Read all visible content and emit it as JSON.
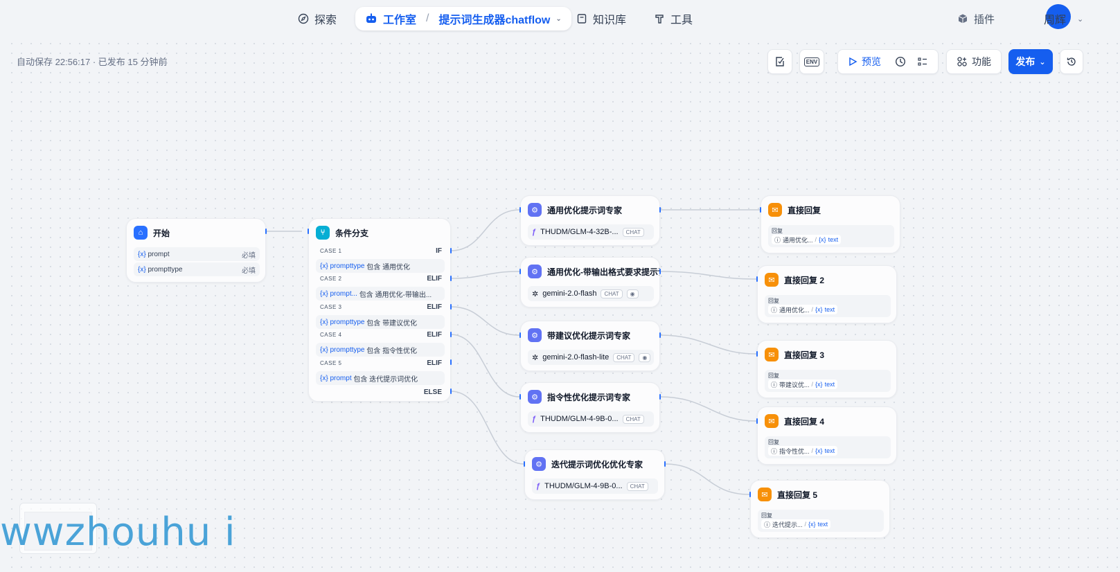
{
  "nav": {
    "explore": "探索",
    "studio": "工作室",
    "app_name": "提示词生成器chatflow",
    "knowledge": "知识库",
    "tools": "工具",
    "plugins": "插件",
    "user": "周辉"
  },
  "status": {
    "autosave": "自动保存 22:56:17 · 已发布 15 分钟前"
  },
  "toolbar": {
    "env": "ENV",
    "preview": "预览",
    "features": "功能",
    "publish": "发布"
  },
  "nodes": {
    "start": {
      "title": "开始",
      "vars": [
        {
          "name": "prompt",
          "req": "必填"
        },
        {
          "name": "prompttype",
          "req": "必填"
        }
      ]
    },
    "branch": {
      "title": "条件分支",
      "cases": [
        {
          "label": "CASE 1",
          "kw": "IF",
          "var": "prompttype",
          "op": "包含",
          "val": "通用优化"
        },
        {
          "label": "CASE 2",
          "kw": "ELIF",
          "var": "prompt...",
          "op": "包含",
          "val": "通用优化-带输出..."
        },
        {
          "label": "CASE 3",
          "kw": "ELIF",
          "var": "prompttype",
          "op": "包含",
          "val": "带建议优化"
        },
        {
          "label": "CASE 4",
          "kw": "ELIF",
          "var": "prompttype",
          "op": "包含",
          "val": "指令性优化"
        },
        {
          "label": "CASE 5",
          "kw": "ELIF",
          "var": "prompt",
          "op": "包含",
          "val": "迭代提示词优化"
        }
      ],
      "else": "ELSE"
    },
    "llm": [
      {
        "title": "通用优化提示词专家",
        "model": "THUDM/GLM-4-32B-...",
        "tag": "CHAT"
      },
      {
        "title": "通用优化-带输出格式要求提示词",
        "model": "gemini-2.0-flash",
        "tag": "CHAT"
      },
      {
        "title": "带建议优化提示词专家",
        "model": "gemini-2.0-flash-lite",
        "tag": "CHAT"
      },
      {
        "title": "指令性优化提示词专家",
        "model": "THUDM/GLM-4-9B-0...",
        "tag": "CHAT"
      },
      {
        "title": "迭代提示词优化优化专家",
        "model": "THUDM/GLM-4-9B-0...",
        "tag": "CHAT"
      }
    ],
    "answer": [
      {
        "title": "直接回复",
        "label": "回复",
        "src": "通用优化...",
        "var": "text"
      },
      {
        "title": "直接回复 2",
        "label": "回复",
        "src": "通用优化...",
        "var": "text"
      },
      {
        "title": "直接回复 3",
        "label": "回复",
        "src": "带建议优...",
        "var": "text"
      },
      {
        "title": "直接回复 4",
        "label": "回复",
        "src": "指令性优...",
        "var": "text"
      },
      {
        "title": "直接回复 5",
        "label": "回复",
        "src": "迭代提示...",
        "var": "text"
      }
    ]
  },
  "var_symbol": "{x}",
  "watermark": "wwzhouhu i"
}
